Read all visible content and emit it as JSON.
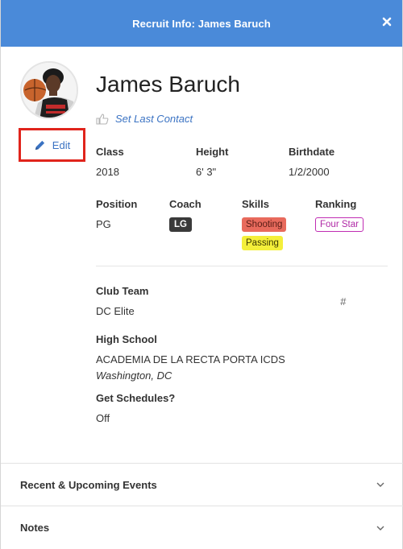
{
  "header": {
    "title": "Recruit Info: James Baruch"
  },
  "profile": {
    "name": "James Baruch",
    "edit_label": "Edit",
    "last_contact_label": "Set Last Contact"
  },
  "details": {
    "class_label": "Class",
    "class_value": "2018",
    "height_label": "Height",
    "height_value": "6' 3\"",
    "birthdate_label": "Birthdate",
    "birthdate_value": "1/2/2000",
    "position_label": "Position",
    "position_value": "PG",
    "coach_label": "Coach",
    "coach_value": "LG",
    "skills_label": "Skills",
    "skills": [
      "Shooting",
      "Passing"
    ],
    "ranking_label": "Ranking",
    "ranking_value": "Four Star"
  },
  "club": {
    "label": "Club Team",
    "value": "DC Elite",
    "number_symbol": "#"
  },
  "school": {
    "label": "High School",
    "name": "ACADEMIA DE LA RECTA PORTA ICDS",
    "location": "Washington, DC"
  },
  "schedules": {
    "label": "Get Schedules?",
    "value": "Off"
  },
  "sections": [
    {
      "label": "Recent & Upcoming Events"
    },
    {
      "label": "Notes"
    }
  ],
  "colors": {
    "header_bg": "#4a8ad9",
    "link": "#3b73c3",
    "highlight_border": "#e0241c",
    "shooting_bg": "#e86a5c",
    "passing_bg": "#f4ef3a",
    "ranking_border": "#c02cb3"
  },
  "icons": [
    "close-icon",
    "pencil-icon",
    "thumbs-up-icon",
    "chevron-down-icon"
  ]
}
